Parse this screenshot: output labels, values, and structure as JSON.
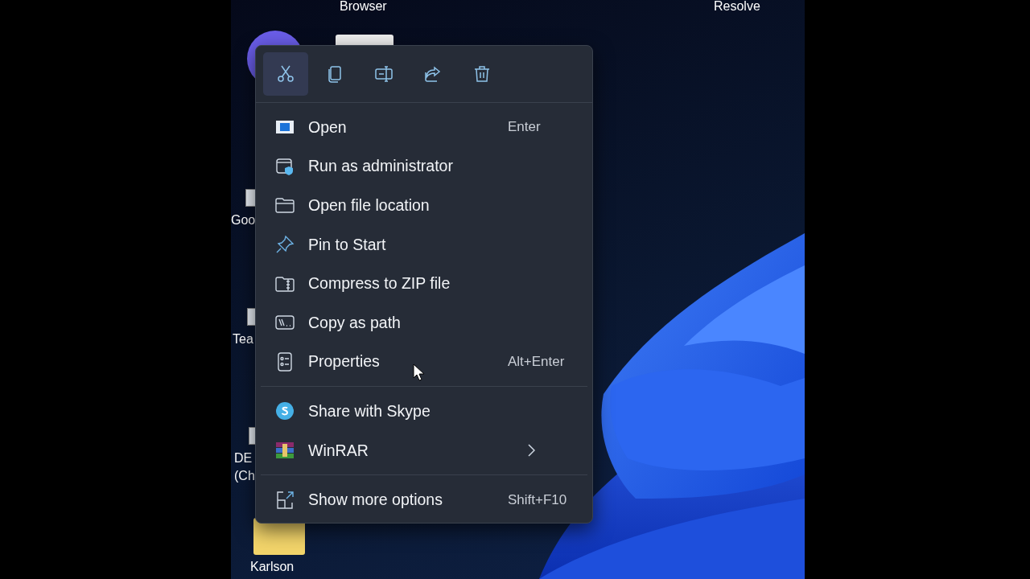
{
  "desktop_icons": [
    {
      "lines": [
        "Browser"
      ],
      "kind": "app"
    },
    {
      "lines": [
        "Resolve"
      ],
      "kind": "label"
    },
    {
      "kind": "round"
    },
    {
      "lines": [
        "Goo"
      ],
      "kind": "shortcut"
    },
    {
      "lines": [
        "Tea"
      ],
      "kind": "shortcut"
    },
    {
      "lines": [
        "DE",
        "(Ch"
      ],
      "kind": "shortcut"
    },
    {
      "lines": [
        "Karlson"
      ],
      "kind": "folder"
    }
  ],
  "context_menu": {
    "toolbar": [
      {
        "selected": true
      },
      {
        "selected": false
      },
      {
        "selected": false
      },
      {
        "selected": false
      },
      {
        "selected": false
      }
    ],
    "items": [
      {
        "kind": "item",
        "label": "Open",
        "shortcut": "Enter",
        "submenu": false
      },
      {
        "kind": "item",
        "label": "Run as administrator",
        "submenu": false
      },
      {
        "kind": "item",
        "label": "Open file location",
        "submenu": false
      },
      {
        "kind": "item",
        "label": "Pin to Start",
        "submenu": false
      },
      {
        "kind": "item",
        "label": "Compress to ZIP file",
        "submenu": false
      },
      {
        "kind": "item",
        "label": "Copy as path",
        "submenu": false
      },
      {
        "kind": "item",
        "label": "Properties",
        "shortcut": "Alt+Enter",
        "submenu": false
      },
      {
        "kind": "separator"
      },
      {
        "kind": "item",
        "label": "Share with Skype",
        "submenu": false
      },
      {
        "kind": "item",
        "label": "WinRAR",
        "submenu": true
      },
      {
        "kind": "separator"
      },
      {
        "kind": "item",
        "label": "Show more options",
        "shortcut": "Shift+F10",
        "submenu": false
      }
    ]
  }
}
